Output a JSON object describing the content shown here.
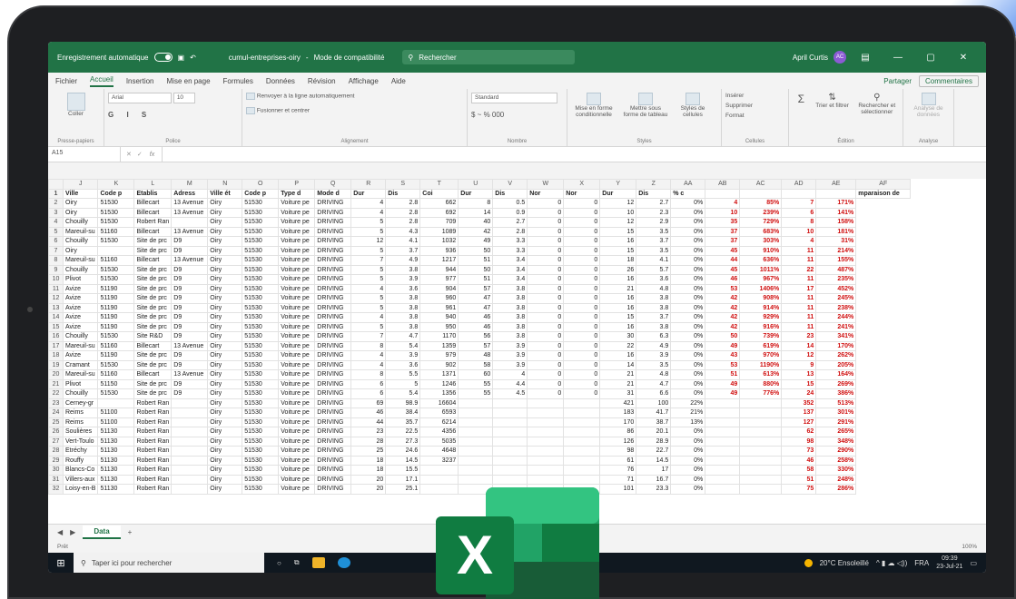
{
  "titlebar": {
    "autosave": "Enregistrement automatique",
    "filename": "cumul-entreprises-oiry",
    "mode": "Mode de compatibilité",
    "search": "Rechercher",
    "user": "April Curtis",
    "initials": "AC"
  },
  "menu": [
    "Fichier",
    "Accueil",
    "Insertion",
    "Mise en page",
    "Formules",
    "Données",
    "Révision",
    "Affichage",
    "Aide"
  ],
  "share": {
    "partager": "Partager",
    "comments": "Commentaires"
  },
  "ribbon": {
    "coller": "Coller",
    "font_name": "Arial",
    "font_size": "10",
    "wrap": "Renvoyer à la ligne automatiquement",
    "merge": "Fusionner et centrer",
    "number_format": "Standard",
    "cond_format": "Mise en forme conditionnelle",
    "table_format": "Mettre sous forme de tableau",
    "cell_styles": "Styles de cellules",
    "insert": "Insérer",
    "delete": "Supprimer",
    "format": "Format",
    "sort": "Trier et filtrer",
    "find": "Rechercher et sélectionner",
    "analyze": "Analyse de données",
    "groups": [
      "Presse-papiers",
      "Police",
      "Alignement",
      "Nombre",
      "Styles",
      "Cellules",
      "Édition",
      "Analyse"
    ]
  },
  "formula": {
    "cell": "A15",
    "fx": "fx"
  },
  "columns": [
    "J",
    "K",
    "L",
    "M",
    "N",
    "O",
    "P",
    "Q",
    "R",
    "S",
    "T",
    "U",
    "V",
    "W",
    "X",
    "Y",
    "Z",
    "AA",
    "AB",
    "AC",
    "AD",
    "AE",
    "AF"
  ],
  "header_row": [
    "1",
    "Ville",
    "Code p",
    "Etablis",
    "Adress",
    "Ville ét",
    "Code p",
    "Type d",
    "Mode d",
    "Dur",
    "Dis",
    "Coi",
    "Dur",
    "Dis",
    "Nor",
    "Nor",
    "Dur",
    "Dis",
    "% c",
    "",
    "",
    "",
    "",
    "mparaison de"
  ],
  "rows": [
    [
      "2",
      "Oiry",
      "51530",
      "Billecart",
      "13 Avenue",
      "Oiry",
      "51530",
      "Voiture pe",
      "DRIVING",
      "4",
      "2.8",
      "662",
      "8",
      "0.5",
      "0",
      "0",
      "12",
      "2.7",
      "0%",
      "4",
      "85%",
      "7",
      "171%"
    ],
    [
      "3",
      "Oiry",
      "51530",
      "Billecart",
      "13 Avenue",
      "Oiry",
      "51530",
      "Voiture pe",
      "DRIVING",
      "4",
      "2.8",
      "692",
      "14",
      "0.9",
      "0",
      "0",
      "10",
      "2.3",
      "0%",
      "10",
      "239%",
      "6",
      "141%"
    ],
    [
      "4",
      "Chouilly",
      "51530",
      "Robert Ran",
      "",
      "Oiry",
      "51530",
      "Voiture pe",
      "DRIVING",
      "5",
      "2.8",
      "709",
      "40",
      "2.7",
      "0",
      "0",
      "12",
      "2.9",
      "0%",
      "35",
      "729%",
      "8",
      "158%"
    ],
    [
      "5",
      "Mareuil-su",
      "51160",
      "Billecart",
      "13 Avenue",
      "Oiry",
      "51530",
      "Voiture pe",
      "DRIVING",
      "5",
      "4.3",
      "1089",
      "42",
      "2.8",
      "0",
      "0",
      "15",
      "3.5",
      "0%",
      "37",
      "683%",
      "10",
      "181%"
    ],
    [
      "6",
      "Chouilly",
      "51530",
      "Site de prc",
      "D9",
      "Oiry",
      "51530",
      "Voiture pe",
      "DRIVING",
      "12",
      "4.1",
      "1032",
      "49",
      "3.3",
      "0",
      "0",
      "16",
      "3.7",
      "0%",
      "37",
      "303%",
      "4",
      "31%"
    ],
    [
      "7",
      "Oiry",
      "",
      "Site de prc",
      "D9",
      "Oiry",
      "51530",
      "Voiture pe",
      "DRIVING",
      "5",
      "3.7",
      "936",
      "50",
      "3.3",
      "0",
      "0",
      "15",
      "3.5",
      "0%",
      "45",
      "910%",
      "11",
      "214%"
    ],
    [
      "8",
      "Mareuil-su",
      "51160",
      "Billecart",
      "13 Avenue",
      "Oiry",
      "51530",
      "Voiture pe",
      "DRIVING",
      "7",
      "4.9",
      "1217",
      "51",
      "3.4",
      "0",
      "0",
      "18",
      "4.1",
      "0%",
      "44",
      "636%",
      "11",
      "155%"
    ],
    [
      "9",
      "Chouilly",
      "51530",
      "Site de prc",
      "D9",
      "Oiry",
      "51530",
      "Voiture pe",
      "DRIVING",
      "5",
      "3.8",
      "944",
      "50",
      "3.4",
      "0",
      "0",
      "26",
      "5.7",
      "0%",
      "45",
      "1011%",
      "22",
      "487%"
    ],
    [
      "10",
      "Plivot",
      "51530",
      "Site de prc",
      "D9",
      "Oiry",
      "51530",
      "Voiture pe",
      "DRIVING",
      "5",
      "3.9",
      "977",
      "51",
      "3.4",
      "0",
      "0",
      "16",
      "3.6",
      "0%",
      "46",
      "967%",
      "11",
      "235%"
    ],
    [
      "11",
      "Avize",
      "51190",
      "Site de prc",
      "D9",
      "Oiry",
      "51530",
      "Voiture pe",
      "DRIVING",
      "4",
      "3.6",
      "904",
      "57",
      "3.8",
      "0",
      "0",
      "21",
      "4.8",
      "0%",
      "53",
      "1406%",
      "17",
      "452%"
    ],
    [
      "12",
      "Avize",
      "51190",
      "Site de prc",
      "D9",
      "Oiry",
      "51530",
      "Voiture pe",
      "DRIVING",
      "5",
      "3.8",
      "960",
      "47",
      "3.8",
      "0",
      "0",
      "16",
      "3.8",
      "0%",
      "42",
      "908%",
      "11",
      "245%"
    ],
    [
      "13",
      "Avize",
      "51190",
      "Site de prc",
      "D9",
      "Oiry",
      "51530",
      "Voiture pe",
      "DRIVING",
      "5",
      "3.8",
      "961",
      "47",
      "3.8",
      "0",
      "0",
      "16",
      "3.8",
      "0%",
      "42",
      "914%",
      "11",
      "238%"
    ],
    [
      "14",
      "Avize",
      "51190",
      "Site de prc",
      "D9",
      "Oiry",
      "51530",
      "Voiture pe",
      "DRIVING",
      "4",
      "3.8",
      "940",
      "46",
      "3.8",
      "0",
      "0",
      "15",
      "3.7",
      "0%",
      "42",
      "929%",
      "11",
      "244%"
    ],
    [
      "15",
      "Avize",
      "51190",
      "Site de prc",
      "D9",
      "Oiry",
      "51530",
      "Voiture pe",
      "DRIVING",
      "5",
      "3.8",
      "950",
      "46",
      "3.8",
      "0",
      "0",
      "16",
      "3.8",
      "0%",
      "42",
      "916%",
      "11",
      "241%"
    ],
    [
      "16",
      "Chouilly",
      "51530",
      "Site R&D",
      "D9",
      "Oiry",
      "51530",
      "Voiture pe",
      "DRIVING",
      "7",
      "4.7",
      "1170",
      "56",
      "3.8",
      "0",
      "0",
      "30",
      "6.3",
      "0%",
      "50",
      "739%",
      "23",
      "341%"
    ],
    [
      "17",
      "Mareuil-su",
      "51160",
      "Billecart",
      "13 Avenue",
      "Oiry",
      "51530",
      "Voiture pe",
      "DRIVING",
      "8",
      "5.4",
      "1359",
      "57",
      "3.9",
      "0",
      "0",
      "22",
      "4.9",
      "0%",
      "49",
      "619%",
      "14",
      "170%"
    ],
    [
      "18",
      "Avize",
      "51190",
      "Site de prc",
      "D9",
      "Oiry",
      "51530",
      "Voiture pe",
      "DRIVING",
      "4",
      "3.9",
      "979",
      "48",
      "3.9",
      "0",
      "0",
      "16",
      "3.9",
      "0%",
      "43",
      "970%",
      "12",
      "262%"
    ],
    [
      "19",
      "Cramant",
      "51530",
      "Site de prc",
      "D9",
      "Oiry",
      "51530",
      "Voiture pe",
      "DRIVING",
      "4",
      "3.6",
      "902",
      "58",
      "3.9",
      "0",
      "0",
      "14",
      "3.5",
      "0%",
      "53",
      "1190%",
      "9",
      "205%"
    ],
    [
      "20",
      "Mareuil-su",
      "51160",
      "Billecart",
      "13 Avenue",
      "Oiry",
      "51530",
      "Voiture pe",
      "DRIVING",
      "8",
      "5.5",
      "1371",
      "60",
      "4",
      "0",
      "0",
      "21",
      "4.8",
      "0%",
      "51",
      "613%",
      "13",
      "164%"
    ],
    [
      "21",
      "Plivot",
      "51150",
      "Site de prc",
      "D9",
      "Oiry",
      "51530",
      "Voiture pe",
      "DRIVING",
      "6",
      "5",
      "1246",
      "55",
      "4.4",
      "0",
      "0",
      "21",
      "4.7",
      "0%",
      "49",
      "880%",
      "15",
      "269%"
    ],
    [
      "22",
      "Chouilly",
      "51530",
      "Site de prc",
      "D9",
      "Oiry",
      "51530",
      "Voiture pe",
      "DRIVING",
      "6",
      "5.4",
      "1356",
      "55",
      "4.5",
      "0",
      "0",
      "31",
      "6.6",
      "0%",
      "49",
      "776%",
      "24",
      "386%"
    ],
    [
      "23",
      "Cerney-gr",
      "",
      "Robert Ran",
      "",
      "Oiry",
      "51530",
      "Voiture pe",
      "DRIVING",
      "69",
      "98.9",
      "16604",
      "",
      "",
      "",
      "",
      "421",
      "100",
      "22%",
      "",
      "",
      "352",
      "513%"
    ],
    [
      "24",
      "Reims",
      "51100",
      "Robert Ran",
      "",
      "Oiry",
      "51530",
      "Voiture pe",
      "DRIVING",
      "46",
      "38.4",
      "6593",
      "",
      "",
      "",
      "",
      "183",
      "41.7",
      "21%",
      "",
      "",
      "137",
      "301%"
    ],
    [
      "25",
      "Reims",
      "51100",
      "Robert Ran",
      "",
      "Oiry",
      "51530",
      "Voiture pe",
      "DRIVING",
      "44",
      "35.7",
      "6214",
      "",
      "",
      "",
      "",
      "170",
      "38.7",
      "13%",
      "",
      "",
      "127",
      "291%"
    ],
    [
      "26",
      "Soulières",
      "51130",
      "Robert Ran",
      "",
      "Oiry",
      "51530",
      "Voiture pe",
      "DRIVING",
      "23",
      "22.5",
      "4356",
      "",
      "",
      "",
      "",
      "86",
      "20.1",
      "0%",
      "",
      "",
      "62",
      "265%"
    ],
    [
      "27",
      "Vert-Toulo",
      "51130",
      "Robert Ran",
      "",
      "Oiry",
      "51530",
      "Voiture pe",
      "DRIVING",
      "28",
      "27.3",
      "5035",
      "",
      "",
      "",
      "",
      "126",
      "28.9",
      "0%",
      "",
      "",
      "98",
      "348%"
    ],
    [
      "28",
      "Etréchy",
      "51130",
      "Robert Ran",
      "",
      "Oiry",
      "51530",
      "Voiture pe",
      "DRIVING",
      "25",
      "24.6",
      "4648",
      "",
      "",
      "",
      "",
      "98",
      "22.7",
      "0%",
      "",
      "",
      "73",
      "290%"
    ],
    [
      "29",
      "Rouffy",
      "51130",
      "Robert Ran",
      "",
      "Oiry",
      "51530",
      "Voiture pe",
      "DRIVING",
      "18",
      "14.5",
      "3237",
      "",
      "",
      "",
      "",
      "61",
      "14.5",
      "0%",
      "",
      "",
      "46",
      "258%"
    ],
    [
      "30",
      "Blancs-Co",
      "51130",
      "Robert Ran",
      "",
      "Oiry",
      "51530",
      "Voiture pe",
      "DRIVING",
      "18",
      "15.5",
      "",
      "",
      "",
      "",
      "",
      "76",
      "17",
      "0%",
      "",
      "",
      "58",
      "330%"
    ],
    [
      "31",
      "Villers-aux",
      "51130",
      "Robert Ran",
      "",
      "Oiry",
      "51530",
      "Voiture pe",
      "DRIVING",
      "20",
      "17.1",
      "",
      "",
      "",
      "",
      "",
      "71",
      "16.7",
      "0%",
      "",
      "",
      "51",
      "248%"
    ],
    [
      "32",
      "Loisy-en-B",
      "51130",
      "Robert Ran",
      "",
      "Oiry",
      "51530",
      "Voiture pe",
      "DRIVING",
      "20",
      "25.1",
      "",
      "",
      "",
      "",
      "",
      "101",
      "23.3",
      "0%",
      "",
      "",
      "75",
      "286%"
    ]
  ],
  "sheet": {
    "tab": "Data",
    "add": "+"
  },
  "status": {
    "ready": "Prêt",
    "zoom": "100%"
  },
  "taskbar": {
    "search": "Taper ici pour rechercher",
    "weather": "20°C Ensoleillé",
    "lang": "FRA",
    "time": "09:39",
    "date": "23-Jul-21"
  },
  "colors": {
    "excel_green": "#217346",
    "red_value": "#d01010"
  }
}
